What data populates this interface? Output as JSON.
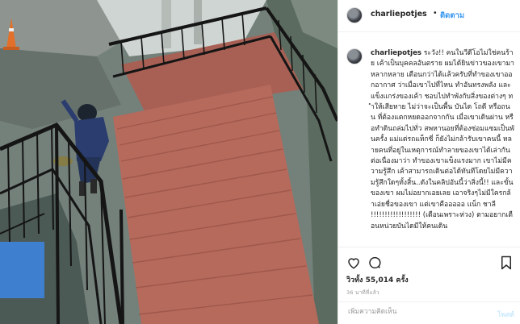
{
  "header": {
    "username": "charliepotjes",
    "separator": "•",
    "follow_label": "ติดตาม"
  },
  "caption": {
    "username": "charliepotjes",
    "text": "ระวัง!! คนในวีดีโอไม่ใช่คนร้าย เค้าเป็นบุคคลอันตราย ผมได้ยินข่าวของเขามาหลากหลาย เตือนกว่าได้แล้วครับที่ทำของเขาออกอากาศ ว่าเมื่อเขาไปที่ไหน ทำอันทรงพลัง และแข็งแกร่งของเค้า ชอบไปทำพังกับสิ่งของต่างๆ ทำให้เสียหาย ไม่ว่าจะเป็นพื้น บันได โถดี หรือถนน ที่ต้องแตกหยดออกจากกัน เมื่อเขาเดินผ่าน หรือทำดินถล่มไปทั่ว สพหานอยที่ต้องซ่อมแซมเป็นพันครั้ง แม่แต่รถแท็กซี่ ก็ยังไม่กล้ารับเขาคนนี้ หลายคนที่อยู่ในเหตุการณ์ทำลายของเขาได้เล่ากันต่อเนื่องมาว่า ทำของเขาแข็งแรงมาก เขาไม่มีความรู้สึก เค้าสามารถเดินต่อได้ทันทีโดยไม่มีความรู้สึกใดๆทั้งสิ้น..ดังในคลิปอันนี้ว่าสิ่งนี้!! และขั้นของเขา ผมไม่อยากเอยเลย เอาจริงๆไม่มีใครกล้าเอ่ยชื่อของเขา แต่เขาคือออออ แน็ก ชาลี !!!!!!!!!!!!!!!!!! (เตือนเพราะห่วง) ตามอยากเตือนหน่วยบันไดมีให้คนเดิน"
  },
  "stats": {
    "likes_text": "วิวทั้ง 55,014 ครั้ง",
    "time_ago": "36 นาทีที่แล้ว"
  },
  "comment": {
    "placeholder": "เพิ่มความคิดเห็น",
    "post_label": "โพสต์"
  },
  "icons": {
    "like": "heart-icon",
    "comment": "comment-bubble-icon",
    "save": "bookmark-icon",
    "avatar": "profile-avatar"
  },
  "colors": {
    "accent": "#3897f0",
    "text": "#262626",
    "muted": "#999999",
    "deck": "#b5675a",
    "railing": "#151515"
  }
}
